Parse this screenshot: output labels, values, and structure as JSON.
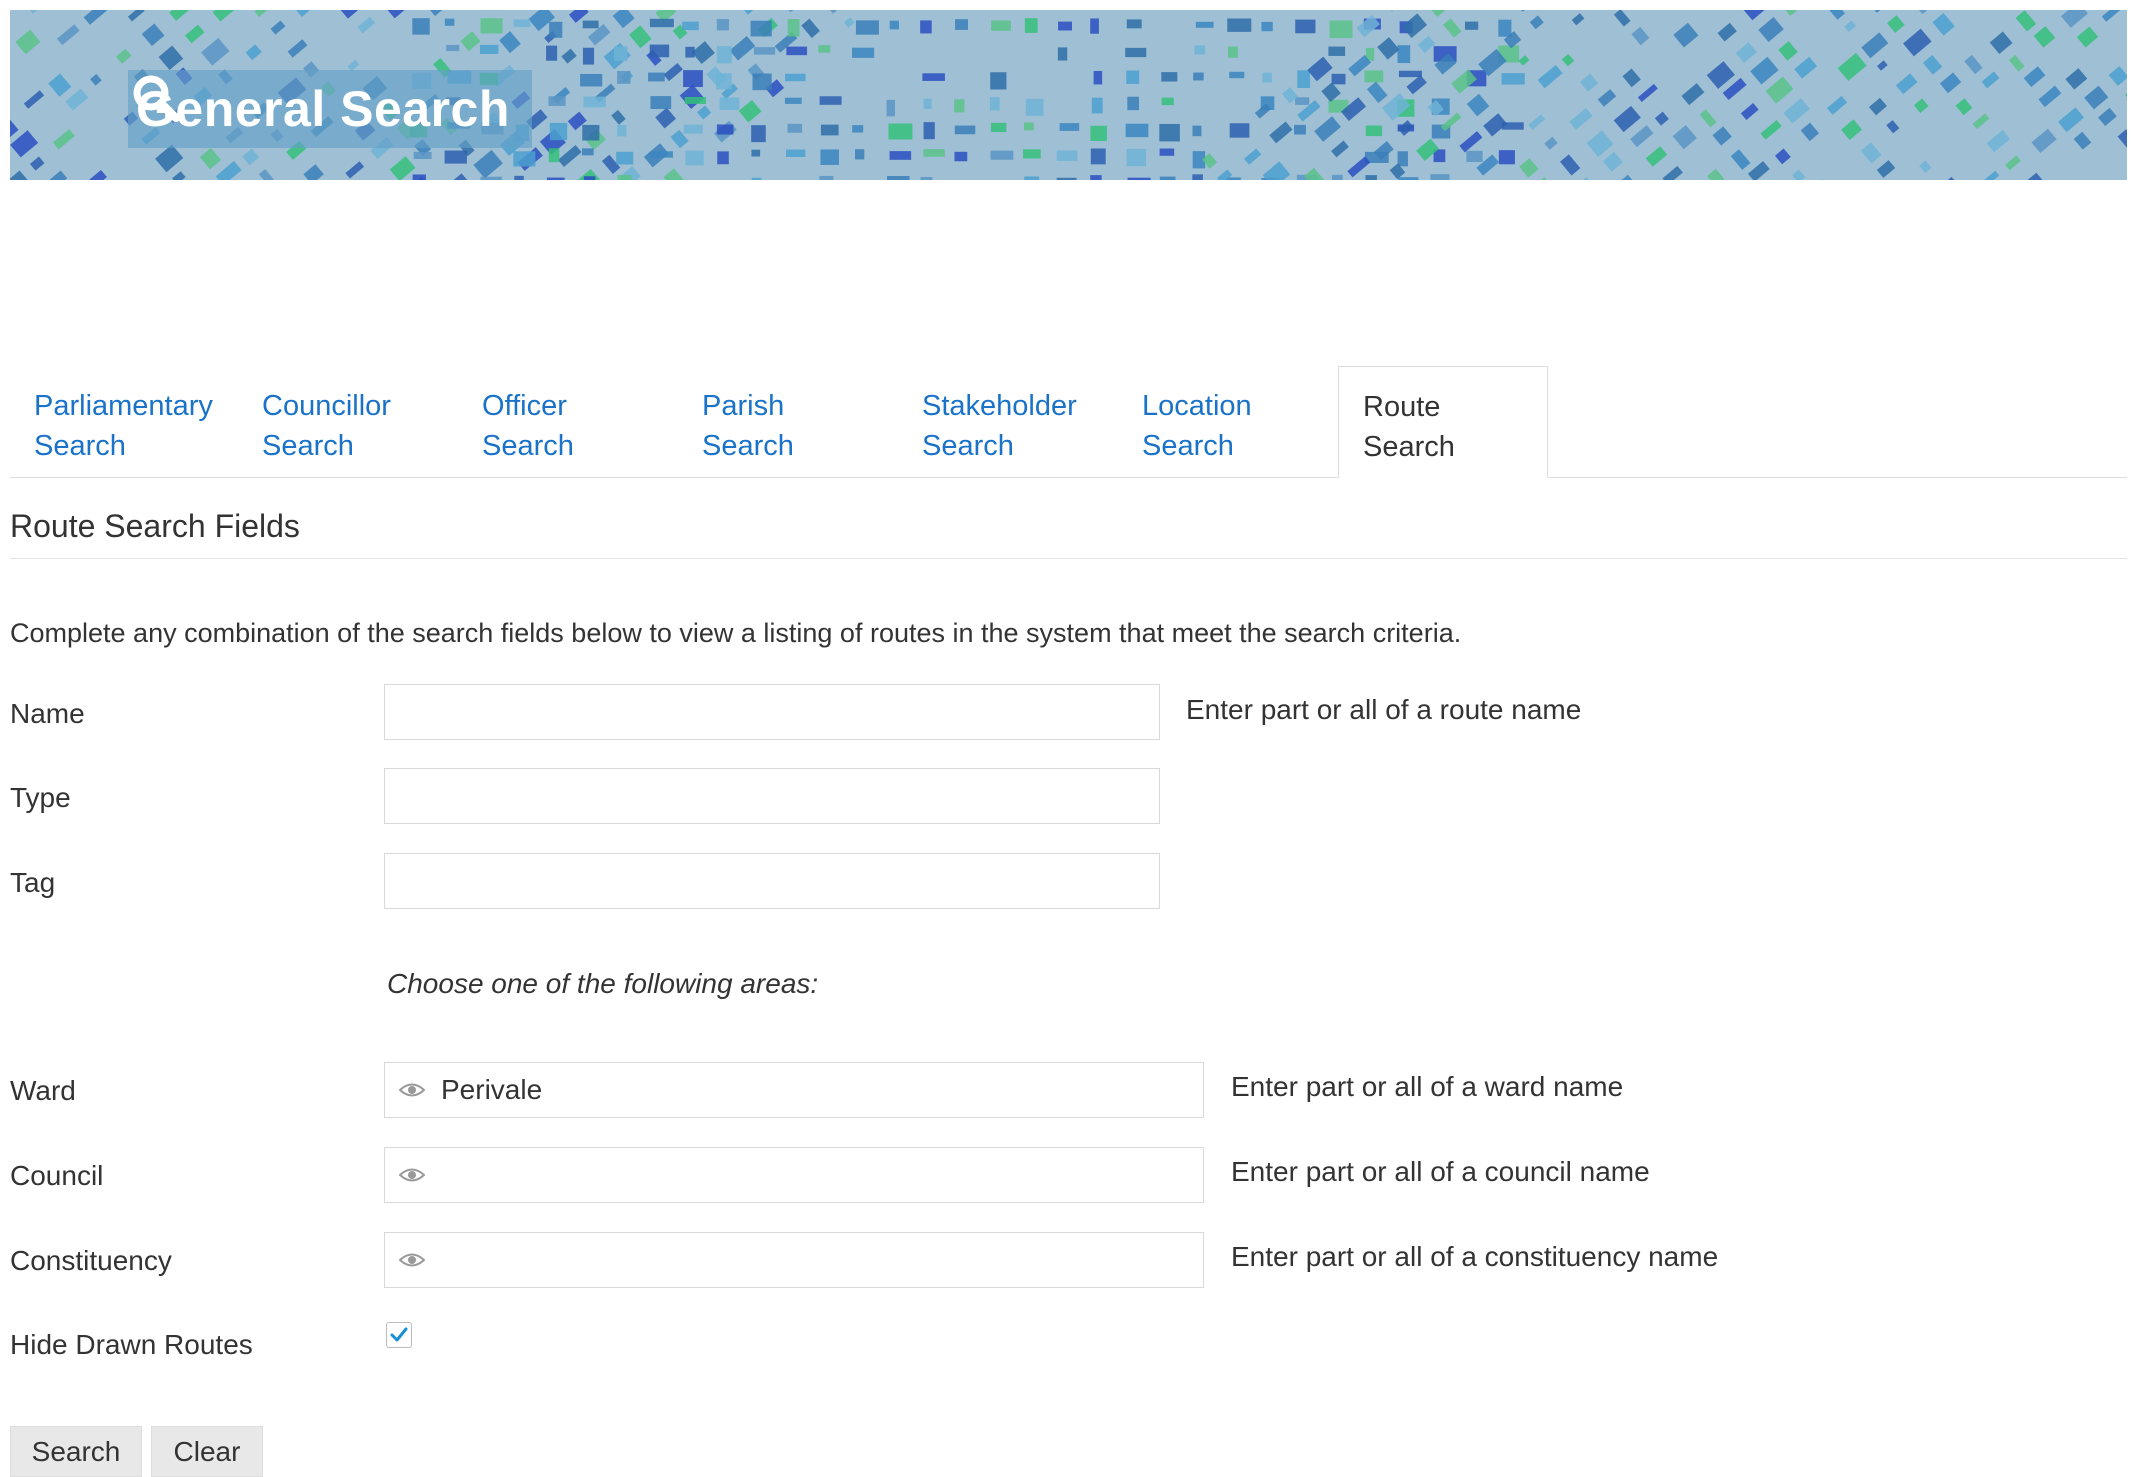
{
  "banner": {
    "title": "General Search",
    "icon": "search-icon"
  },
  "tabs": [
    {
      "line1": "Parliamentary",
      "line2": "Search",
      "active": false
    },
    {
      "line1": "Councillor",
      "line2": "Search",
      "active": false
    },
    {
      "line1": "Officer",
      "line2": "Search",
      "active": false
    },
    {
      "line1": "Parish",
      "line2": "Search",
      "active": false
    },
    {
      "line1": "Stakeholder",
      "line2": "Search",
      "active": false
    },
    {
      "line1": "Location",
      "line2": "Search",
      "active": false
    },
    {
      "line1": "Route",
      "line2": "Search",
      "active": true
    }
  ],
  "section": {
    "title": "Route Search Fields",
    "intro": "Complete any combination of the search fields below to view a listing of routes in the system that meet the search criteria."
  },
  "fields": {
    "name": {
      "label": "Name",
      "value": "",
      "hint": "Enter part or all of a route name"
    },
    "type": {
      "label": "Type",
      "value": ""
    },
    "tag": {
      "label": "Tag",
      "value": ""
    },
    "choose_text": "Choose one of the following areas:",
    "ward": {
      "label": "Ward",
      "value": "Perivale",
      "hint": "Enter part or all of a ward name"
    },
    "council": {
      "label": "Council",
      "value": "",
      "hint": "Enter part or all of a council name"
    },
    "constituency": {
      "label": "Constituency",
      "value": "",
      "hint": "Enter part or all of a constituency name"
    },
    "hide_drawn": {
      "label": "Hide Drawn Routes",
      "checked": true
    }
  },
  "buttons": {
    "search": "Search",
    "clear": "Clear"
  },
  "colors": {
    "link": "#1a73c8",
    "banner_base": "#9ebfd4",
    "check": "#1a8fd8"
  }
}
